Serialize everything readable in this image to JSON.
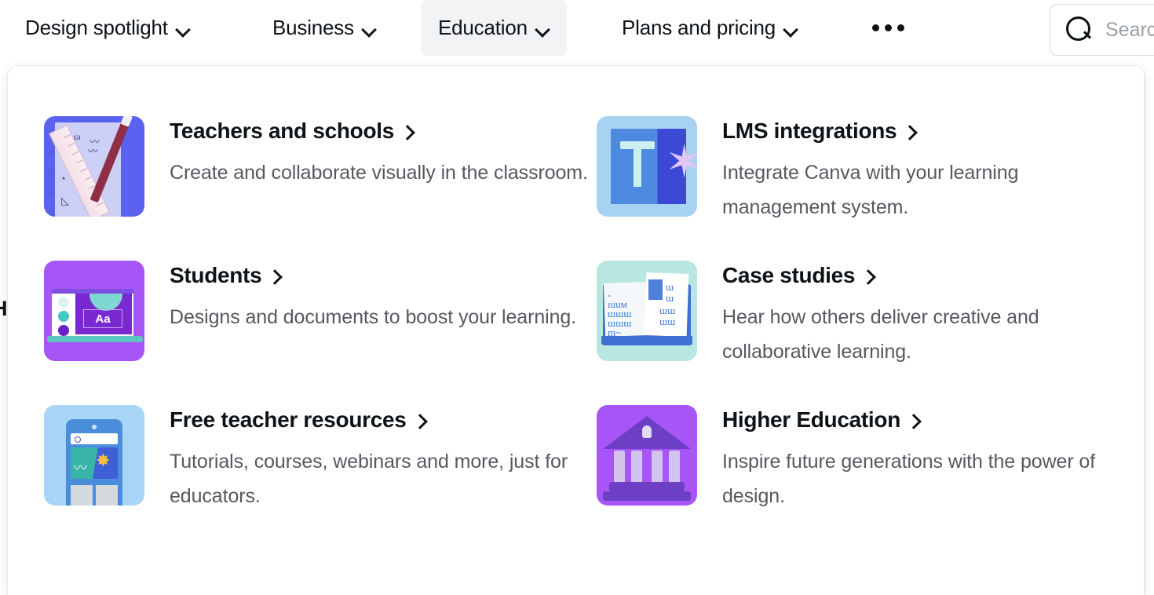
{
  "topnav": {
    "items": [
      {
        "label": "Design spotlight",
        "has_chevron": true,
        "active": false,
        "icon": "chevron-down-icon"
      },
      {
        "label": "Business",
        "has_chevron": true,
        "active": false,
        "icon": "chevron-down-icon"
      },
      {
        "label": "Education",
        "has_chevron": true,
        "active": true,
        "icon": "chevron-down-icon"
      },
      {
        "label": "Plans and pricing",
        "has_chevron": true,
        "active": false,
        "icon": "chevron-down-icon"
      }
    ],
    "more_label": "•••",
    "more_icon": "ellipsis-icon",
    "search": {
      "icon": "search-icon",
      "placeholder": "Search"
    }
  },
  "edge_text": "H",
  "dropdown": {
    "items": [
      {
        "title": "Teachers and schools",
        "description": "Create and collaborate visually in the classroom.",
        "thumb_icon": "notebook-ruler-pencil-icon",
        "thumb_bg": "#5c62f0",
        "arrow_icon": "chevron-right-icon"
      },
      {
        "title": "LMS integrations",
        "description": "Integrate Canva with your learning management system.",
        "thumb_icon": "text-tool-star-icon",
        "thumb_bg": "#a8d2f2",
        "arrow_icon": "chevron-right-icon"
      },
      {
        "title": "Students",
        "description": "Designs and documents to boost your learning.",
        "thumb_icon": "laptop-design-icon",
        "thumb_bg": "#a855f7",
        "arrow_icon": "chevron-right-icon"
      },
      {
        "title": "Case studies",
        "description": "Hear how others deliver creative and collaborative learning.",
        "thumb_icon": "open-book-icon",
        "thumb_bg": "#b8e6e0",
        "arrow_icon": "chevron-right-icon"
      },
      {
        "title": "Free teacher resources",
        "description": "Tutorials, courses, webinars and more, just for educators.",
        "thumb_icon": "mobile-phone-icon",
        "thumb_bg": "#a8d4f5",
        "arrow_icon": "chevron-right-icon"
      },
      {
        "title": "Higher Education",
        "description": "Inspire future generations with the power of design.",
        "thumb_icon": "university-building-icon",
        "thumb_bg": "#a855f7",
        "arrow_icon": "chevron-right-icon"
      }
    ]
  },
  "colors": {
    "text_primary": "#0e1318",
    "text_secondary": "#55595f",
    "active_tab_bg": "#f2f3f5",
    "panel_bg": "#ffffff"
  }
}
